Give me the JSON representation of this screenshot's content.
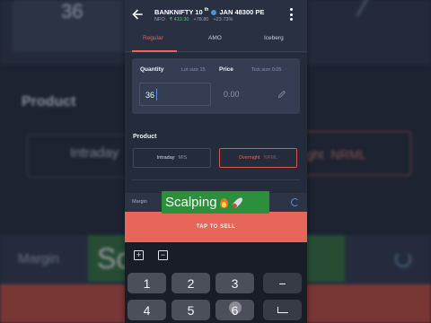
{
  "background": {
    "quantity_value": "36",
    "product_heading": "Product",
    "intraday_label": "Intraday",
    "overnight_label": "ight",
    "overnight_code": "NRML",
    "margin_label": "Margin",
    "banner_text": "Sc"
  },
  "header": {
    "instrument": "BANKNIFTY 10",
    "instrument_sup": "th",
    "instrument_suffix": "JAN 48300 PE",
    "exchange": "NFO",
    "ltp": "₹ 410.30",
    "change": "+78.80",
    "change_pct": "+23.73%"
  },
  "tabs": [
    {
      "label": "Regular",
      "active": true
    },
    {
      "label": "AMO",
      "active": false
    },
    {
      "label": "Iceberg",
      "active": false
    }
  ],
  "order": {
    "quantity_label": "Quantity",
    "lot_size": "Lot size  15",
    "quantity_value": "36",
    "price_label": "Price",
    "tick_size": "Tick size  0.05",
    "price_placeholder": "0.00"
  },
  "product": {
    "heading": "Product",
    "options": [
      {
        "label": "Intraday",
        "code": "MIS",
        "selected": false
      },
      {
        "label": "Overnight",
        "code": "NRML",
        "selected": true
      }
    ]
  },
  "margin": {
    "label": "Margin"
  },
  "banner": {
    "text": "Scalping"
  },
  "action": {
    "sell_label": "TAP TO SELL",
    "accent": "#e8655a"
  },
  "keyboard": {
    "tools": [
      "plus-square-icon",
      "minus-square-icon"
    ],
    "row1": [
      "1",
      "2",
      "3",
      "−"
    ],
    "row2": [
      "4",
      "5",
      "6",
      "enter-icon"
    ]
  },
  "colors": {
    "panel": "#283042",
    "accent_red": "#e8655a",
    "positive": "#4fc07a",
    "banner_green": "#2c8f3c"
  }
}
